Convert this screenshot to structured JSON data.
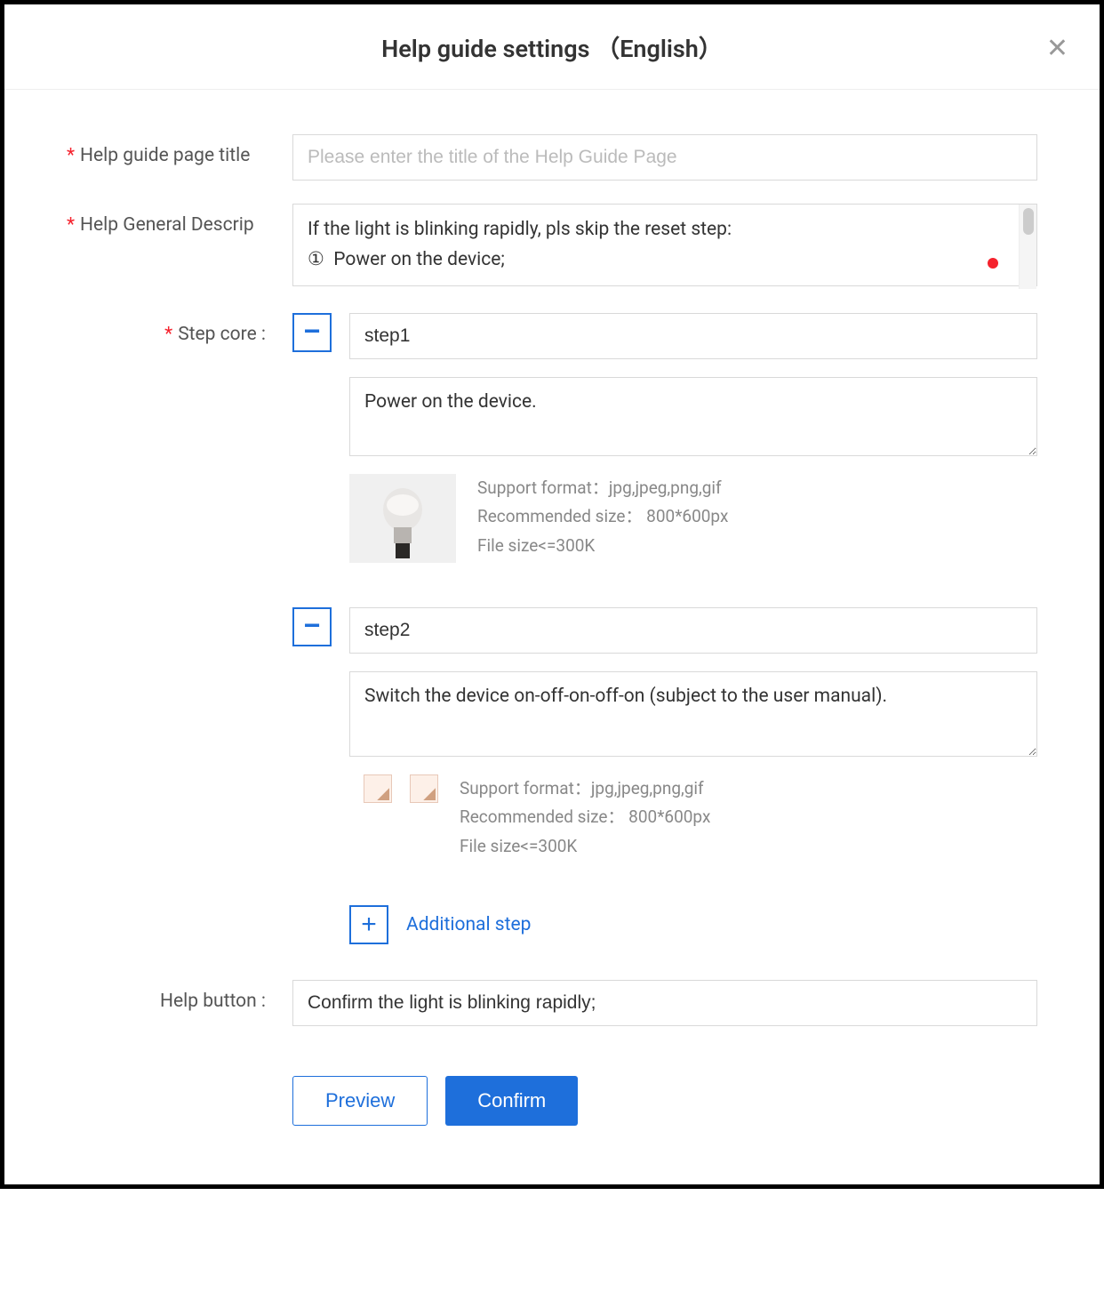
{
  "modal": {
    "title": "Help guide settings （English）"
  },
  "form": {
    "page_title": {
      "label": "Help guide page title",
      "placeholder": "Please enter the title of the Help Guide Page",
      "value": ""
    },
    "general_desc": {
      "label": "Help General Descrip",
      "value": "If the light is blinking rapidly, pls skip the reset step:\n①  Power on the device;"
    },
    "step_core": {
      "label": "Step core :"
    },
    "steps": [
      {
        "title": "step1",
        "desc": "Power on the device.",
        "has_image": true
      },
      {
        "title": "step2",
        "desc": "Switch the device on-off-on-off-on (subject to the user manual).",
        "has_image": false
      }
    ],
    "upload_hints": {
      "format": "Support format：jpg,jpeg,png,gif",
      "size": "Recommended size： 800*600px",
      "file": "File size<=300K"
    },
    "add_step_label": "Additional step",
    "help_button": {
      "label": "Help button :",
      "value": "Confirm the light is blinking rapidly;"
    },
    "preview_label": "Preview",
    "confirm_label": "Confirm"
  }
}
